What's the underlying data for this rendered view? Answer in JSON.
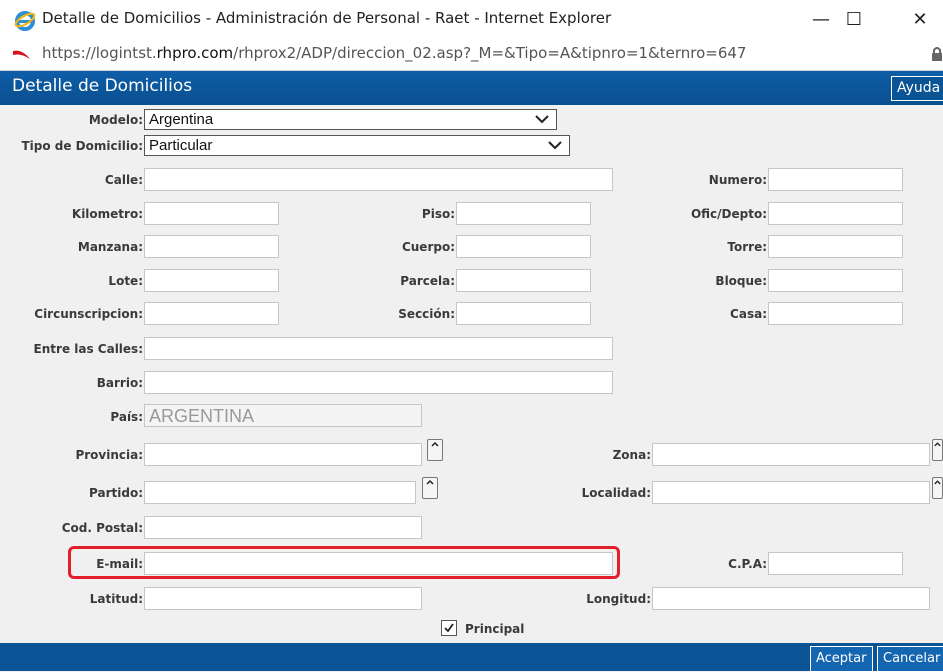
{
  "window": {
    "title": "Detalle de Domicilios - Administración de Personal - Raet - Internet Explorer",
    "minimize": "—",
    "maximize": "☐",
    "close": "✕"
  },
  "address": {
    "url_prefix": "https://logintst.",
    "url_domain": "rhpro.com",
    "url_rest": "/rhprox2/ADP/direccion_02.asp?_M=&Tipo=A&tipnro=1&ternro=647"
  },
  "header": {
    "title": "Detalle de Domicilios",
    "help_label": "Ayuda"
  },
  "form": {
    "modelo_label": "Modelo:",
    "modelo_value": "Argentina",
    "tipo_label": "Tipo de Domicilio:",
    "tipo_value": "Particular",
    "calle_label": "Calle:",
    "numero_label": "Numero:",
    "kilometro_label": "Kilometro:",
    "piso_label": "Piso:",
    "ofic_label": "Ofic/Depto:",
    "manzana_label": "Manzana:",
    "cuerpo_label": "Cuerpo:",
    "torre_label": "Torre:",
    "lote_label": "Lote:",
    "parcela_label": "Parcela:",
    "bloque_label": "Bloque:",
    "circ_label": "Circunscripcion:",
    "seccion_label": "Sección:",
    "casa_label": "Casa:",
    "entre_label": "Entre las Calles:",
    "barrio_label": "Barrio:",
    "pais_label": "País:",
    "pais_value": "ARGENTINA",
    "provincia_label": "Provincia:",
    "zona_label": "Zona:",
    "partido_label": "Partido:",
    "localidad_label": "Localidad:",
    "cp_label": "Cod. Postal:",
    "email_label": "E-mail:",
    "cpa_label": "C.P.A:",
    "latitud_label": "Latitud:",
    "longitud_label": "Longitud:",
    "principal_label": "Principal",
    "principal_checked": true
  },
  "footer": {
    "accept_label": "Aceptar",
    "cancel_label": "Cancelar"
  },
  "colors": {
    "header_blue": "#0a5394",
    "highlight_red": "#e31f2e"
  }
}
